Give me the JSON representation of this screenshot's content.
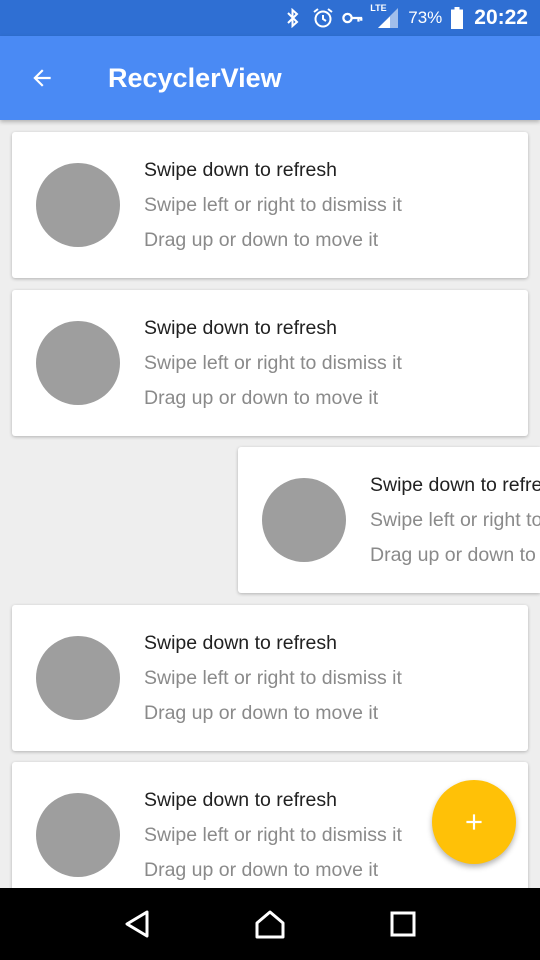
{
  "status_bar": {
    "icons": [
      "bluetooth-icon",
      "alarm-icon",
      "vpn-key-icon",
      "lte-signal-icon",
      "battery-icon"
    ],
    "network_label": "LTE",
    "battery_percent": "73%",
    "time": "20:22"
  },
  "app_bar": {
    "title": "RecyclerView",
    "back_icon": "arrow-back-icon",
    "color": "#4a8af4"
  },
  "cards": [
    {
      "line1": "Swipe down to refresh",
      "line2": "Swipe left or right to dismiss it",
      "line3": "Drag up or down to move it"
    },
    {
      "line1": "Swipe down to refresh",
      "line2": "Swipe left or right to dismiss it",
      "line3": "Drag up or down to move it"
    },
    {
      "line1": "Swipe down to refresh",
      "line2": "Swipe left or right to dismiss it",
      "line3": "Drag up or down to move it"
    },
    {
      "line1": "Swipe down to refresh",
      "line2": "Swipe left or right to dismiss it",
      "line3": "Drag up or down to move it"
    },
    {
      "line1": "Swipe down to refresh",
      "line2": "Swipe left or right to dismiss it",
      "line3": "Drag up or down to move it"
    }
  ],
  "fab": {
    "icon": "plus-icon",
    "color": "#ffc107"
  },
  "nav_bar": {
    "icons": [
      "back-triangle-icon",
      "home-icon",
      "recents-square-icon"
    ]
  }
}
